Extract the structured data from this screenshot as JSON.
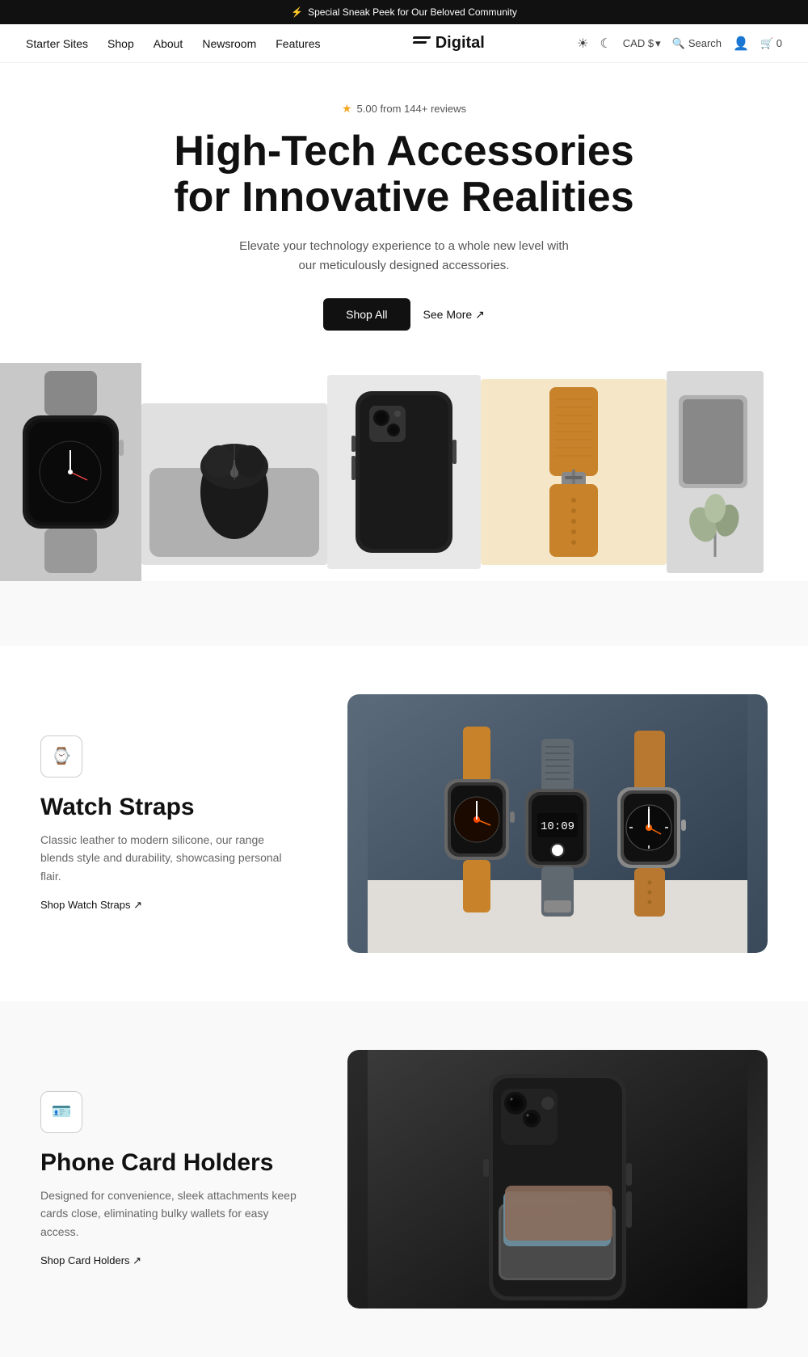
{
  "announcement": {
    "icon": "⚡",
    "text": "Special Sneak Peek for Our Beloved Community"
  },
  "header": {
    "nav": [
      "Starter Sites",
      "Shop",
      "About",
      "Newsroom",
      "Features"
    ],
    "logo": "Digital",
    "currency": "CAD $",
    "currency_arrow": "▾",
    "search_label": "Search",
    "cart_count": "0"
  },
  "hero": {
    "rating_star": "★",
    "rating_text": "5.00 from 144+ reviews",
    "headline": "High-Tech Accessories for Innovative Realities",
    "subtext": "Elevate your technology experience to a whole new level with our meticulously designed accessories.",
    "btn_shop_all": "Shop All",
    "btn_see_more": "See More ↗"
  },
  "gallery": {
    "items": [
      {
        "label": "Apple Watch",
        "type": "watch"
      },
      {
        "label": "Mouse & Pad",
        "type": "mouse"
      },
      {
        "label": "Phone Case",
        "type": "case"
      },
      {
        "label": "Watch Strap",
        "type": "strap"
      },
      {
        "label": "Accessory",
        "type": "misc"
      }
    ]
  },
  "sections": [
    {
      "id": "watch-straps",
      "icon": "⌚",
      "title": "Watch Straps",
      "description": "Classic leather to modern silicone, our range blends style and durability, showcasing personal flair.",
      "link_text": "Shop Watch Straps ↗",
      "image_type": "watchstraps"
    },
    {
      "id": "phone-card-holders",
      "icon": "🪪",
      "title": "Phone Card Holders",
      "description": "Designed for convenience, sleek attachments keep cards close, eliminating bulky wallets for easy access.",
      "link_text": "Shop Card Holders ↗",
      "image_type": "phoneholder"
    }
  ]
}
